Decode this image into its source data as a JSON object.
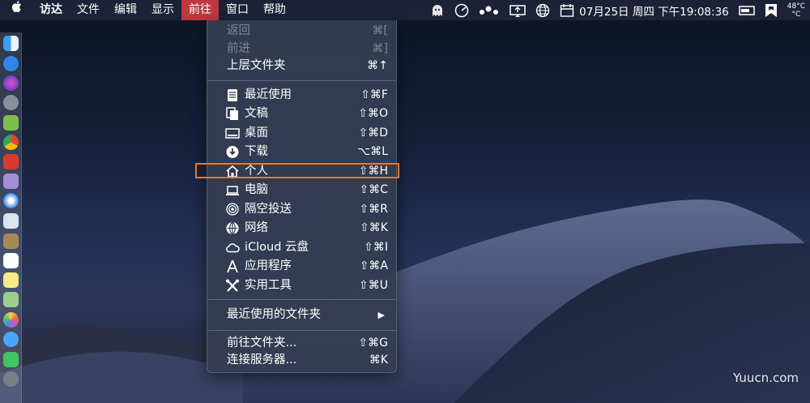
{
  "menubar": {
    "items": [
      "访达",
      "文件",
      "编辑",
      "显示",
      "前往",
      "窗口",
      "帮助"
    ],
    "active_index": 4
  },
  "status": {
    "date_time": "07月25日 周四 下午19:08:36",
    "temperature": "48°C",
    "temp_unit": "°C"
  },
  "menu": {
    "back": {
      "label": "返回",
      "shortcut": "⌘["
    },
    "forward": {
      "label": "前进",
      "shortcut": "⌘]"
    },
    "parent": {
      "label": "上层文件夹",
      "shortcut": "⌘↑"
    },
    "items": [
      {
        "label": "最近使用",
        "shortcut": "⇧⌘F",
        "icon": "recents-icon"
      },
      {
        "label": "文稿",
        "shortcut": "⇧⌘O",
        "icon": "documents-icon"
      },
      {
        "label": "桌面",
        "shortcut": "⇧⌘D",
        "icon": "desktop-icon"
      },
      {
        "label": "下载",
        "shortcut": "⌥⌘L",
        "icon": "downloads-icon"
      },
      {
        "label": "个人",
        "shortcut": "⇧⌘H",
        "icon": "home-icon"
      },
      {
        "label": "电脑",
        "shortcut": "⇧⌘C",
        "icon": "computer-icon"
      },
      {
        "label": "隔空投送",
        "shortcut": "⇧⌘R",
        "icon": "airdrop-icon"
      },
      {
        "label": "网络",
        "shortcut": "⇧⌘K",
        "icon": "network-icon"
      },
      {
        "label": "iCloud 云盘",
        "shortcut": "⇧⌘I",
        "icon": "icloud-icon"
      },
      {
        "label": "应用程序",
        "shortcut": "⇧⌘A",
        "icon": "applications-icon"
      },
      {
        "label": "实用工具",
        "shortcut": "⇧⌘U",
        "icon": "utilities-icon"
      }
    ],
    "recent_folders": {
      "label": "最近使用的文件夹",
      "arrow": "▶"
    },
    "goto_folder": {
      "label": "前往文件夹...",
      "shortcut": "⇧⌘G"
    },
    "connect_server": {
      "label": "连接服务器...",
      "shortcut": "⌘K"
    }
  },
  "watermark": "Yuucn.com",
  "colors": {
    "active_menu": "#c0383f",
    "highlight_box": "#e8792b"
  }
}
